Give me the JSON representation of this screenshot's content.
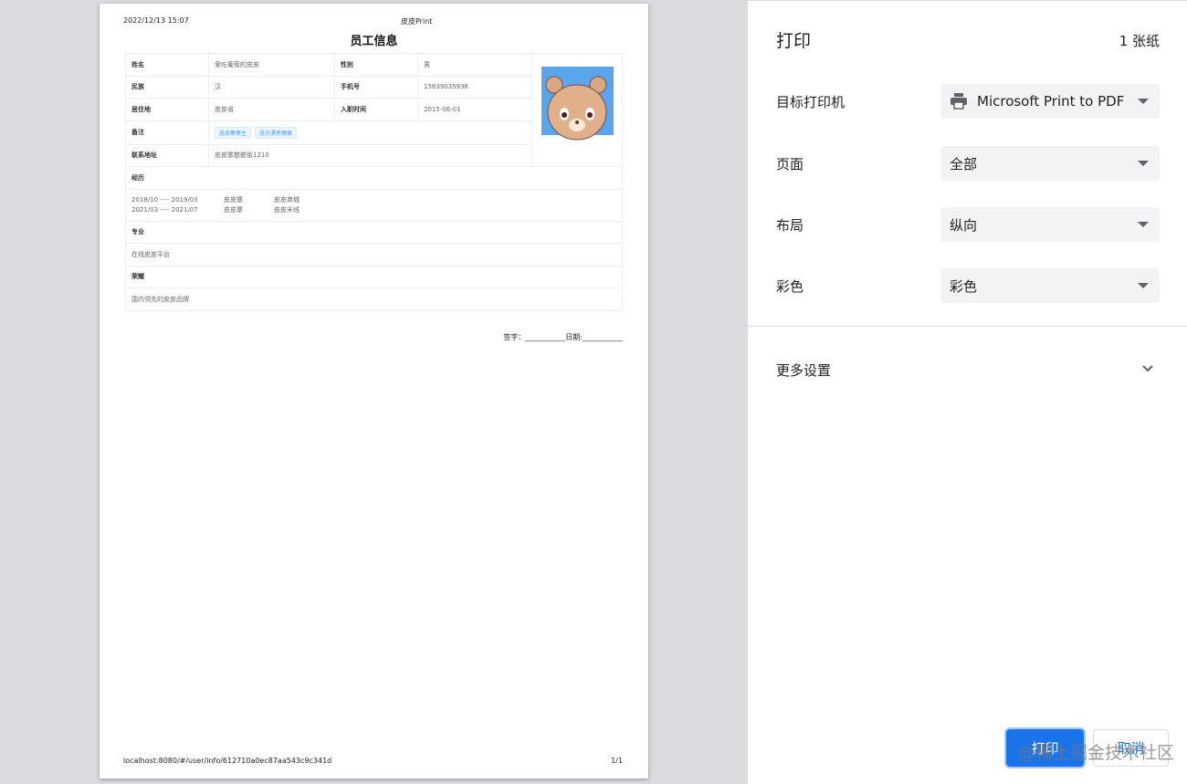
{
  "preview": {
    "date": "2022/12/13 15:07",
    "header_title": "皮皮Print",
    "doc_title": "员工信息",
    "fields": {
      "name_label": "姓名",
      "name": "爱吃葡萄的皮皮",
      "gender_label": "性别",
      "gender": "男",
      "ethnic_label": "民族",
      "ethnic": "汉",
      "phone_label": "手机号",
      "phone": "15639035936",
      "residence_label": "居住地",
      "residence": "皮皮省",
      "hire_label": "入职时间",
      "hire": "2015-06-01",
      "note_label": "备注",
      "tags": [
        "皮皮寨寨主",
        "张大漂亮偶像"
      ],
      "address_label": "联系地址",
      "address": "皮皮寨憨憨街1210"
    },
    "experience_label": "经历",
    "experience": [
      {
        "period": "2018/10 ---- 2019/03",
        "company": "皮皮寨",
        "project": "皮皮商城"
      },
      {
        "period": "2021/03 ---- 2021/07",
        "company": "皮皮寨",
        "project": "皮皮米线"
      }
    ],
    "major_label": "专业",
    "major": "在线皮皮平台",
    "honor_label": "荣耀",
    "honor": "国内领先的皮皮品牌",
    "sign": "签字：___________日期:___________",
    "footer_url": "localhost:8080/#/user/info/612710a0ec87aa543c9c341d",
    "page_num": "1/1"
  },
  "panel": {
    "title": "打印",
    "sheets": "1 张纸",
    "rows": [
      {
        "label": "目标打印机",
        "value": "Microsoft Print to PDF",
        "icon": "printer-icon"
      },
      {
        "label": "页面",
        "value": "全部"
      },
      {
        "label": "布局",
        "value": "纵向"
      },
      {
        "label": "彩色",
        "value": "彩色"
      }
    ],
    "more": "更多设置",
    "print": "打印",
    "cancel": "取消",
    "accent": "#1a73e8"
  },
  "watermark": "@稀土掘金技术社区"
}
